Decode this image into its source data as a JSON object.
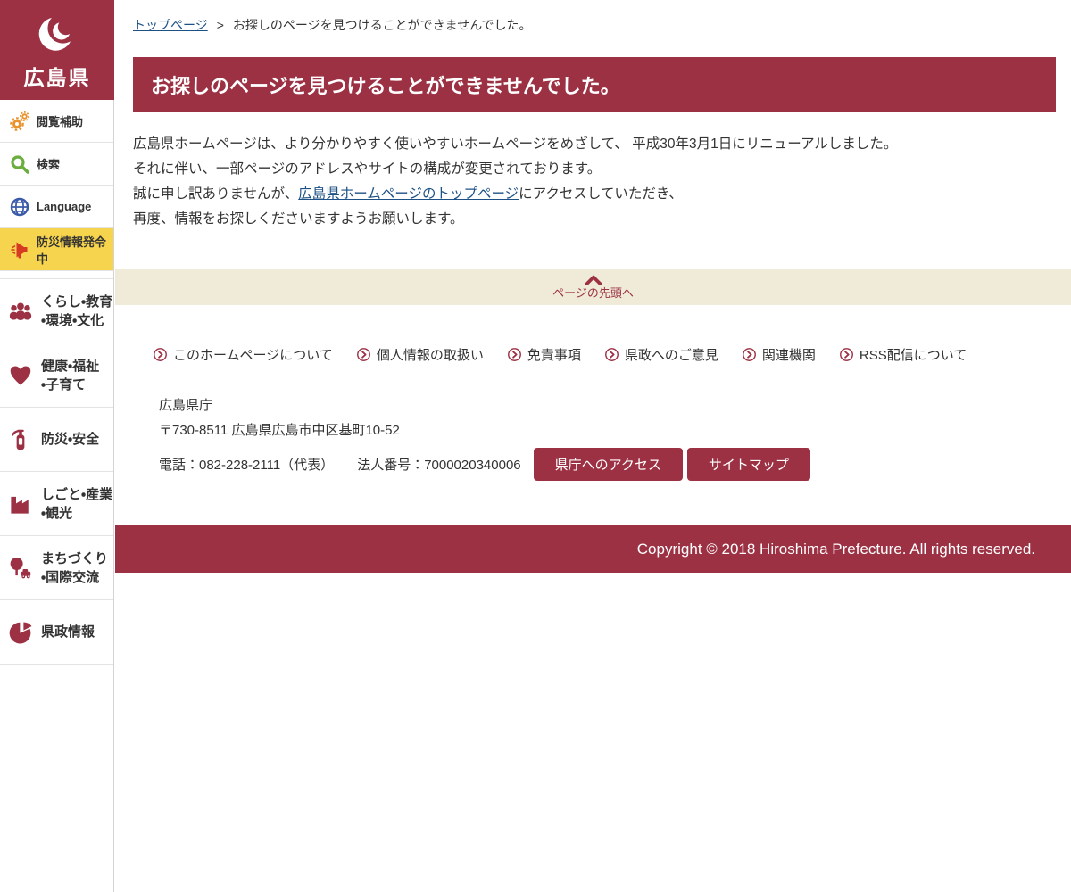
{
  "colors": {
    "primary": "#9c3144",
    "alert_yellow": "#f6d44d",
    "band_beige": "#efebd8",
    "link_blue": "#1d5186",
    "gear_orange": "#e8932f",
    "search_green": "#6cae3e",
    "globe_blue": "#3a5ba9",
    "megaphone_red": "#d63a22"
  },
  "logo": {
    "text": "広島県",
    "icon": "hiroshima-emblem-icon"
  },
  "sidebar": {
    "utility": [
      {
        "label": "閲覧補助",
        "icon": "gears-icon"
      },
      {
        "label": "検索",
        "icon": "search-icon"
      },
      {
        "label": "Language",
        "icon": "globe-icon"
      },
      {
        "label": "防災情報発令中",
        "icon": "megaphone-icon"
      }
    ],
    "categories": [
      {
        "label": "くらし・教育\n・環境・文化",
        "icon": "people-icon"
      },
      {
        "label": "健康・福祉\n・子育て",
        "icon": "heart-icon"
      },
      {
        "label": "防災・安全",
        "icon": "fire-extinguisher-icon"
      },
      {
        "label": "しごと・産業\n・観光",
        "icon": "factory-icon"
      },
      {
        "label": "まちづくり\n・国際交流",
        "icon": "tree-icon"
      },
      {
        "label": "県政情報",
        "icon": "pie-chart-icon"
      }
    ]
  },
  "breadcrumb": {
    "home": "トップページ",
    "separator": ">",
    "current": "お探しのページを見つけることができませんでした。"
  },
  "main": {
    "heading": "お探しのページを見つけることができませんでした。",
    "p1": "広島県ホームページは、より分かりやすく使いやすいホームページをめざして、 平成30年3月1日にリニューアルしました。",
    "p2": "それに伴い、一部ページのアドレスやサイトの構成が変更されております。",
    "p3_pre": "誠に申し訳ありませんが、",
    "p3_link": "広島県ホームページのトップページ",
    "p3_post": "にアクセスしていただき、",
    "p4": "再度、情報をお探しくださいますようお願いします。",
    "back_to_top": "ページの先頭へ"
  },
  "footer": {
    "links": [
      {
        "label": "このホームページについて"
      },
      {
        "label": "個人情報の取扱い"
      },
      {
        "label": "免責事項"
      },
      {
        "label": "県政へのご意見"
      },
      {
        "label": "関連機関"
      },
      {
        "label": "RSS配信について"
      }
    ],
    "org": "広島県庁",
    "address": "〒730-8511 広島県広島市中区基町10-52",
    "phone": "電話：082-228-2111（代表）",
    "corp_number": "法人番号：7000020340006",
    "buttons": [
      {
        "label": "県庁へのアクセス"
      },
      {
        "label": "サイトマップ"
      }
    ],
    "copyright": "Copyright © 2018 Hiroshima Prefecture. All rights reserved."
  }
}
